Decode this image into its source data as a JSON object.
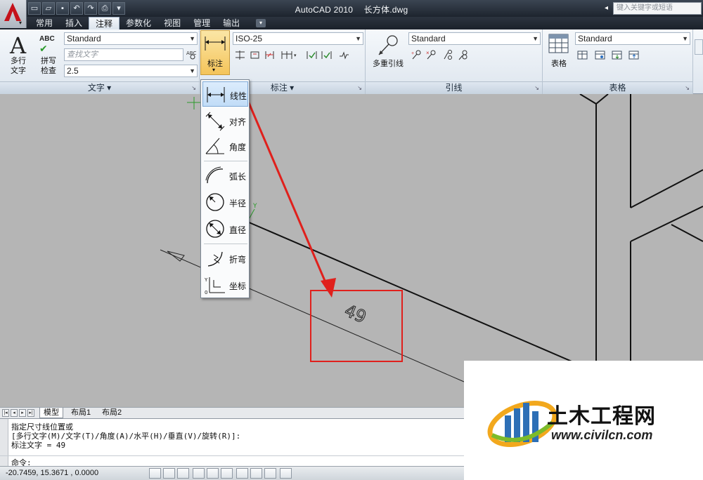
{
  "title_bar": {
    "app_name": "AutoCAD 2010",
    "document": "长方体.dwg",
    "search_placeholder": "键入关键字或短语"
  },
  "tabs": [
    {
      "label": "常用",
      "active": false
    },
    {
      "label": "插入",
      "active": false
    },
    {
      "label": "注释",
      "active": true
    },
    {
      "label": "参数化",
      "active": false
    },
    {
      "label": "视图",
      "active": false
    },
    {
      "label": "管理",
      "active": false
    },
    {
      "label": "输出",
      "active": false
    }
  ],
  "ribbon": {
    "text_panel": {
      "title": "文字",
      "mtext_label": "多行\n文字",
      "spell_label": "拼写\n检查",
      "style_value": "Standard",
      "find_placeholder": "查找文字",
      "height_value": "2.5"
    },
    "dim_panel": {
      "title": "标注",
      "big_button_label": "标注",
      "style_value": "ISO-25"
    },
    "leader_panel": {
      "title": "引线",
      "big_button_label": "多重引线",
      "style_value": "Standard"
    },
    "table_panel": {
      "title": "表格",
      "big_button_label": "表格",
      "style_value": "Standard"
    }
  },
  "dimension_menu": {
    "items": [
      {
        "label": "线性",
        "icon": "linear-dim-icon",
        "highlighted": true
      },
      {
        "label": "对齐",
        "icon": "aligned-dim-icon"
      },
      {
        "label": "角度",
        "icon": "angular-dim-icon"
      },
      {
        "label": "弧长",
        "icon": "arc-length-icon"
      },
      {
        "label": "半径",
        "icon": "radius-icon"
      },
      {
        "label": "直径",
        "icon": "diameter-icon"
      },
      {
        "label": "折弯",
        "icon": "jogged-icon"
      },
      {
        "label": "坐标",
        "icon": "ordinate-icon"
      }
    ]
  },
  "drawing": {
    "dimension_text": "49",
    "highlight_color": "#e0201c",
    "background": "#b5b5b5"
  },
  "layout_tabs": [
    {
      "label": "模型",
      "active": true
    },
    {
      "label": "布局1",
      "active": false
    },
    {
      "label": "布局2",
      "active": false
    }
  ],
  "command_line": {
    "history": [
      "指定尺寸线位置或",
      "[多行文字(M)/文字(T)/角度(A)/水平(H)/垂直(V)/旋转(R)]:",
      "标注文字 = 49"
    ],
    "prompt": "命令:"
  },
  "status_bar": {
    "coordinates": "-20.7459,  15.3671 , 0.0000"
  },
  "watermark": {
    "name": "土木工程网",
    "url": "www.civilcn.com"
  }
}
